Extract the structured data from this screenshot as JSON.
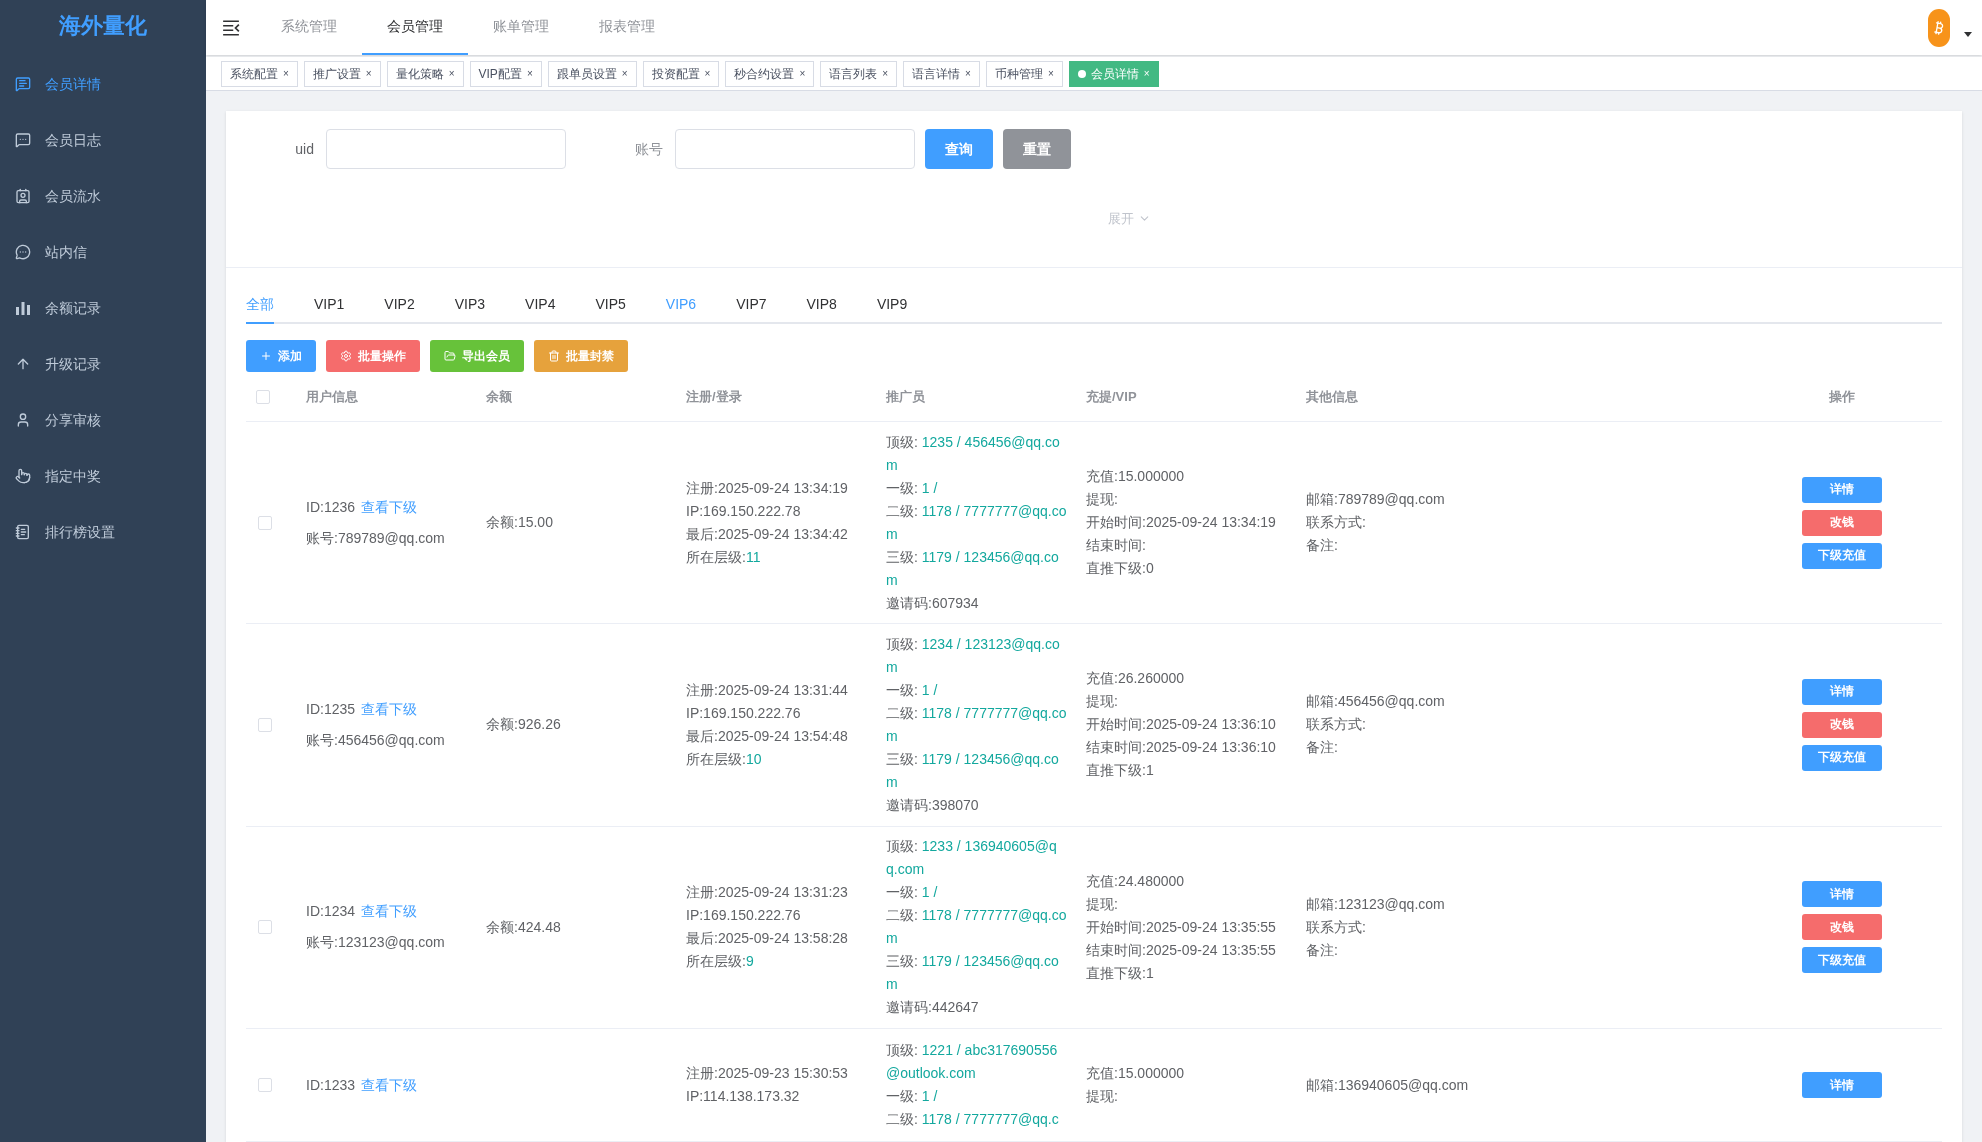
{
  "sidebar": {
    "logo": "海外量化",
    "items": [
      {
        "label": "会员详情",
        "selected": true
      },
      {
        "label": "会员日志",
        "selected": false
      },
      {
        "label": "会员流水",
        "selected": false
      },
      {
        "label": "站内信",
        "selected": false
      },
      {
        "label": "余额记录",
        "selected": false
      },
      {
        "label": "升级记录",
        "selected": false
      },
      {
        "label": "分享审核",
        "selected": false
      },
      {
        "label": "指定中奖",
        "selected": false
      },
      {
        "label": "排行榜设置",
        "selected": false
      }
    ]
  },
  "top_nav": [
    {
      "label": "系统管理",
      "selected": false
    },
    {
      "label": "会员管理",
      "selected": true
    },
    {
      "label": "账单管理",
      "selected": false
    },
    {
      "label": "报表管理",
      "selected": false
    }
  ],
  "tags": [
    {
      "label": "系统配置",
      "close": "×",
      "selected": false
    },
    {
      "label": "推广设置",
      "close": "×",
      "selected": false
    },
    {
      "label": "量化策略",
      "close": "×",
      "selected": false
    },
    {
      "label": "VIP配置",
      "close": "×",
      "selected": false
    },
    {
      "label": "跟单员设置",
      "close": "×",
      "selected": false
    },
    {
      "label": "投资配置",
      "close": "×",
      "selected": false
    },
    {
      "label": "秒合约设置",
      "close": "×",
      "selected": false
    },
    {
      "label": "语言列表",
      "close": "×",
      "selected": false
    },
    {
      "label": "语言详情",
      "close": "×",
      "selected": false
    },
    {
      "label": "币种管理",
      "close": "×",
      "selected": false
    },
    {
      "label": "会员详情",
      "close": "×",
      "selected": true
    }
  ],
  "filter": {
    "fields": [
      {
        "label": "uid"
      },
      {
        "label": "账号"
      }
    ],
    "search_button": "查询",
    "reset_button": "重置",
    "expand": "展开"
  },
  "level_tabs": [
    {
      "label": "全部",
      "selected": true,
      "hovered": false
    },
    {
      "label": "VIP1",
      "selected": false,
      "hovered": false
    },
    {
      "label": "VIP2",
      "selected": false,
      "hovered": false
    },
    {
      "label": "VIP3",
      "selected": false,
      "hovered": false
    },
    {
      "label": "VIP4",
      "selected": false,
      "hovered": false
    },
    {
      "label": "VIP5",
      "selected": false,
      "hovered": false
    },
    {
      "label": "VIP6",
      "selected": false,
      "hovered": true
    },
    {
      "label": "VIP7",
      "selected": false,
      "hovered": false
    },
    {
      "label": "VIP8",
      "selected": false,
      "hovered": false
    },
    {
      "label": "VIP9",
      "selected": false,
      "hovered": false
    }
  ],
  "actions": [
    {
      "label": "添加",
      "kind": "add"
    },
    {
      "label": "批量操作",
      "kind": "batch"
    },
    {
      "label": "导出会员",
      "kind": "export"
    },
    {
      "label": "批量封禁",
      "kind": "ban"
    }
  ],
  "table": {
    "all_checked": false,
    "columns": [
      "用户信息",
      "余额",
      "注册/登录",
      "推广员",
      "充提/VIP",
      "其他信息",
      "操作"
    ],
    "rows": [
      {
        "checked": false,
        "id": "ID:1236",
        "sub_link": "查看下级",
        "account": "账号:789789@qq.com",
        "balance": "余额:15.00",
        "register": [
          {
            "text": "注册:2025-09-24 13:34:19"
          },
          {
            "text": "IP:169.150.222.78"
          },
          {
            "text": "最后:2025-09-24 13:34:42"
          },
          {
            "label": "所在层级:",
            "value": "11"
          }
        ],
        "promoter": [
          {
            "label": "顶级: ",
            "value": "1235 / 456456@qq.com"
          },
          {
            "label": "一级: ",
            "value": "1 /"
          },
          {
            "label": "二级: ",
            "value": "1178 / 7777777@qq.com"
          },
          {
            "label": "三级: ",
            "value": "1179 / 123456@qq.com"
          },
          {
            "text": "邀请码:607934"
          }
        ],
        "recharge": [
          "充值:15.000000",
          "提现:",
          "开始时间:2025-09-24 13:34:19",
          "结束时间:",
          "直推下级:0"
        ],
        "other": [
          "邮箱:789789@qq.com",
          "联系方式:",
          "备注:"
        ],
        "buttons": [
          {
            "label": "详情",
            "kind": "detail"
          },
          {
            "label": "改钱",
            "kind": "edit"
          },
          {
            "label": "下级充值",
            "kind": "recharge"
          }
        ]
      },
      {
        "checked": false,
        "id": "ID:1235",
        "sub_link": "查看下级",
        "account": "账号:456456@qq.com",
        "balance": "余额:926.26",
        "register": [
          {
            "text": "注册:2025-09-24 13:31:44"
          },
          {
            "text": "IP:169.150.222.76"
          },
          {
            "text": "最后:2025-09-24 13:54:48"
          },
          {
            "label": "所在层级:",
            "value": "10"
          }
        ],
        "promoter": [
          {
            "label": "顶级: ",
            "value": "1234 / 123123@qq.com"
          },
          {
            "label": "一级: ",
            "value": "1 /"
          },
          {
            "label": "二级: ",
            "value": "1178 / 7777777@qq.com"
          },
          {
            "label": "三级: ",
            "value": "1179 / 123456@qq.com"
          },
          {
            "text": "邀请码:398070"
          }
        ],
        "recharge": [
          "充值:26.260000",
          "提现:",
          "开始时间:2025-09-24 13:36:10",
          "结束时间:2025-09-24 13:36:10",
          "直推下级:1"
        ],
        "other": [
          "邮箱:456456@qq.com",
          "联系方式:",
          "备注:"
        ],
        "buttons": [
          {
            "label": "详情",
            "kind": "detail"
          },
          {
            "label": "改钱",
            "kind": "edit"
          },
          {
            "label": "下级充值",
            "kind": "recharge"
          }
        ]
      },
      {
        "checked": false,
        "id": "ID:1234",
        "sub_link": "查看下级",
        "account": "账号:123123@qq.com",
        "balance": "余额:424.48",
        "register": [
          {
            "text": "注册:2025-09-24 13:31:23"
          },
          {
            "text": "IP:169.150.222.76"
          },
          {
            "text": "最后:2025-09-24 13:58:28"
          },
          {
            "label": "所在层级:",
            "value": "9"
          }
        ],
        "promoter": [
          {
            "label": "顶级: ",
            "value": "1233 / 136940605@qq.com"
          },
          {
            "label": "一级: ",
            "value": "1 /"
          },
          {
            "label": "二级: ",
            "value": "1178 / 7777777@qq.com"
          },
          {
            "label": "三级: ",
            "value": "1179 / 123456@qq.com"
          },
          {
            "text": "邀请码:442647"
          }
        ],
        "recharge": [
          "充值:24.480000",
          "提现:",
          "开始时间:2025-09-24 13:35:55",
          "结束时间:2025-09-24 13:35:55",
          "直推下级:1"
        ],
        "other": [
          "邮箱:123123@qq.com",
          "联系方式:",
          "备注:"
        ],
        "buttons": [
          {
            "label": "详情",
            "kind": "detail"
          },
          {
            "label": "改钱",
            "kind": "edit"
          },
          {
            "label": "下级充值",
            "kind": "recharge"
          }
        ]
      },
      {
        "checked": false,
        "id": "ID:1233",
        "sub_link": "查看下级",
        "register": [
          {
            "text": "注册:2025-09-23 15:30:53"
          },
          {
            "text": "IP:114.138.173.32"
          }
        ],
        "promoter": [
          {
            "label": "顶级: ",
            "value": "1221 / abc317690556@outlook.com"
          },
          {
            "label": "一级: ",
            "value": "1 /"
          },
          {
            "label": "二级: ",
            "value": "1178 / 7777777@qq.c"
          }
        ],
        "recharge": [
          "充值:15.000000",
          "提现:"
        ],
        "other": [
          "邮箱:136940605@qq.com"
        ],
        "buttons": [
          {
            "label": "详情",
            "kind": "detail"
          }
        ]
      }
    ]
  }
}
